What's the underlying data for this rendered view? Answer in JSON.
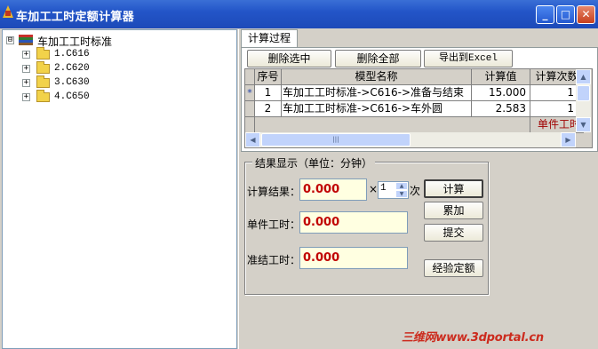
{
  "window": {
    "title": "车加工工时定额计算器"
  },
  "title_buttons": {
    "minimize": "_",
    "maximize": "□",
    "close": "✕"
  },
  "tree": {
    "root": {
      "expander": "⊟",
      "label": "车加工工时标准"
    },
    "items": [
      {
        "expander": "+",
        "label": "1.C616"
      },
      {
        "expander": "+",
        "label": "2.C620"
      },
      {
        "expander": "+",
        "label": "3.C630"
      },
      {
        "expander": "+",
        "label": "4.C650"
      }
    ]
  },
  "tab": {
    "label": "计算过程"
  },
  "toolbar": {
    "delete_selected": "删除选中",
    "delete_all": "删除全部",
    "export_excel": "导出到Excel"
  },
  "grid": {
    "headers": [
      "序号",
      "模型名称",
      "计算值",
      "计算次数"
    ],
    "rows": [
      {
        "marker": "*",
        "index": "1",
        "name": "车加工工时标准->C616->准备与结束",
        "value": "15.000",
        "count": "1"
      },
      {
        "marker": "",
        "index": "2",
        "name": "车加工工时标准->C616->车外圆",
        "value": "2.583",
        "count": "1"
      }
    ],
    "footer_label": "单件工时",
    "scroll_arrows": {
      "up": "▲",
      "down": "▼",
      "left": "◀",
      "right": "▶",
      "grip": "|||"
    }
  },
  "result": {
    "legend": "结果显示（单位：分钟）",
    "calc_result_label": "计算结果：",
    "calc_result_value": "0.000",
    "times_symbol": "×",
    "multiplier": "1",
    "times_unit": "次",
    "single_time_label": "单件工时：",
    "single_time_value": "0.000",
    "setup_time_label": "准结工时：",
    "setup_time_value": "0.000",
    "buttons": {
      "calculate": "计算",
      "accumulate": "累加",
      "submit": "提交",
      "empirical_quota": "经验定额"
    },
    "spin_arrows": {
      "up": "▲",
      "down": "▼"
    }
  },
  "watermark": "三维网www.3dportal.cn"
}
